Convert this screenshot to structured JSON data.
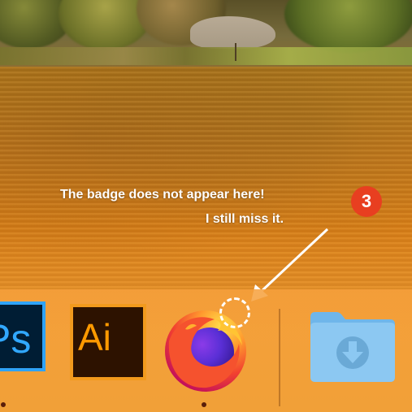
{
  "annotation": {
    "line1": "The badge does not appear here!",
    "line2": "I still miss it.",
    "step_number": "3"
  },
  "dock": {
    "items": [
      {
        "name": "Adobe Photoshop",
        "label": "Ps",
        "running": true
      },
      {
        "name": "Adobe Illustrator",
        "label": "Ai",
        "running": false
      },
      {
        "name": "Firefox",
        "running": true
      },
      {
        "name": "Downloads folder",
        "icon": "download-folder-icon",
        "running": false
      }
    ]
  },
  "colors": {
    "annotation_badge": "#e83f20",
    "ps_accent": "#31a8ff",
    "ai_accent": "#ff9a00",
    "folder": "#7fc1ef"
  }
}
